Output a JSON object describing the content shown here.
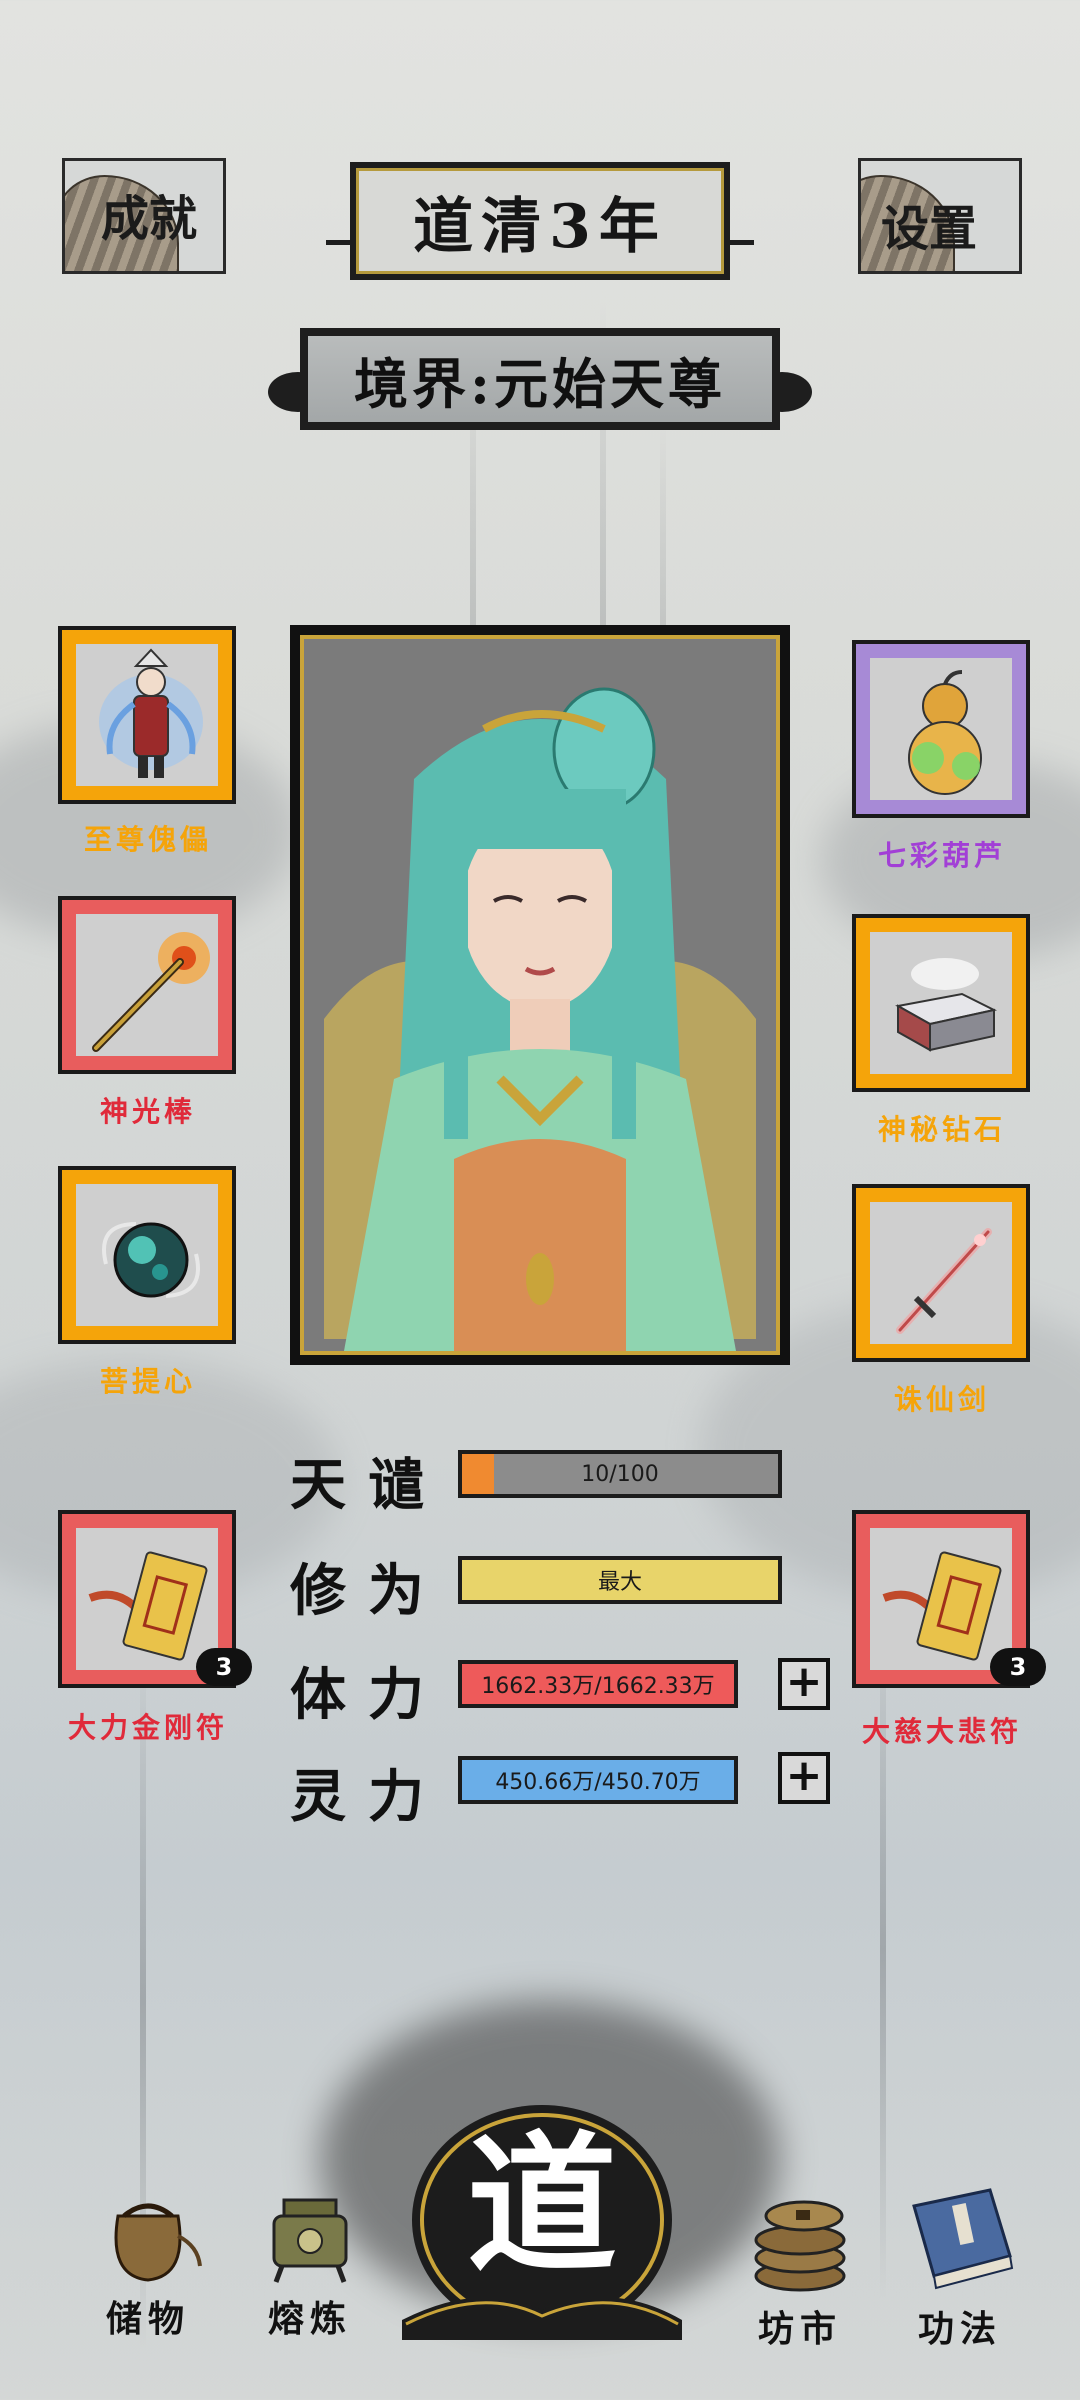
{
  "header": {
    "achievements_label": "成就",
    "settings_label": "设置",
    "year_title": "道清3年",
    "realm_label": "境界:元始天尊"
  },
  "left_items": [
    {
      "name": "至尊傀儡",
      "color": "#f5a40a"
    },
    {
      "name": "神光棒",
      "color": "#e02a3a"
    },
    {
      "name": "菩提心",
      "color": "#f5a40a"
    }
  ],
  "right_items": [
    {
      "name": "七彩葫芦",
      "color": "#a23fd6"
    },
    {
      "name": "神秘钻石",
      "color": "#f5a40a"
    },
    {
      "name": "诛仙剑",
      "color": "#f5a40a"
    }
  ],
  "talismans": [
    {
      "name": "大力金刚符",
      "count": "3"
    },
    {
      "name": "大慈大悲符",
      "count": "3"
    }
  ],
  "stats": {
    "tianqian": {
      "label": "天谴",
      "value": "10/100",
      "fraction": 0.1,
      "fill_color": "#f08a30"
    },
    "xiuwei": {
      "label": "修为",
      "value": "最大",
      "fill_color": "#e8d46a"
    },
    "tili": {
      "label": "体力",
      "value": "1662.33万/1662.33万",
      "fill_color": "#ee5a5a"
    },
    "lingli": {
      "label": "灵力",
      "value": "450.66万/450.70万",
      "fill_color": "#6aaee8"
    }
  },
  "nav": {
    "storage": "储物",
    "smelt": "熔炼",
    "dao": "道",
    "market": "坊市",
    "technique": "功法"
  },
  "colors": {
    "gold_slot": "#f5a40a",
    "red_slot": "#e85d5d",
    "purple_slot": "#a78ad6"
  }
}
